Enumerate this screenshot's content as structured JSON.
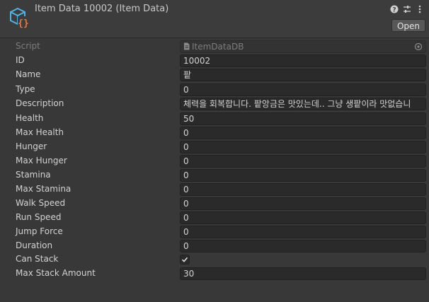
{
  "header": {
    "title": "Item Data 10002 (Item Data)",
    "open_label": "Open",
    "icons": [
      "help-icon",
      "presets-icon",
      "kebab-menu-icon"
    ]
  },
  "script_field": {
    "label": "Script",
    "value": "ItemDataDB"
  },
  "fields": [
    {
      "label": "ID",
      "value": "10002"
    },
    {
      "label": "Name",
      "value": "팥"
    },
    {
      "label": "Type",
      "value": "0"
    },
    {
      "label": "Description",
      "value": "체력을 회복합니다. 팥앙금은 맛있는데.. 그냥 생팥이라 맛없습니"
    },
    {
      "label": "Health",
      "value": "50"
    },
    {
      "label": "Max Health",
      "value": "0"
    },
    {
      "label": "Hunger",
      "value": "0"
    },
    {
      "label": "Max Hunger",
      "value": "0"
    },
    {
      "label": "Stamina",
      "value": "0"
    },
    {
      "label": "Max Stamina",
      "value": "0"
    },
    {
      "label": "Walk Speed",
      "value": "0"
    },
    {
      "label": "Run Speed",
      "value": "0"
    },
    {
      "label": "Jump Force",
      "value": "0"
    },
    {
      "label": "Duration",
      "value": "0"
    }
  ],
  "can_stack": {
    "label": "Can Stack",
    "checked": true
  },
  "max_stack": {
    "label": "Max Stack Amount",
    "value": "30"
  },
  "colors": {
    "background": "#383838",
    "field": "#2a2a2a",
    "icon_blue": "#4fb3e8",
    "icon_orange": "#e8783c"
  }
}
